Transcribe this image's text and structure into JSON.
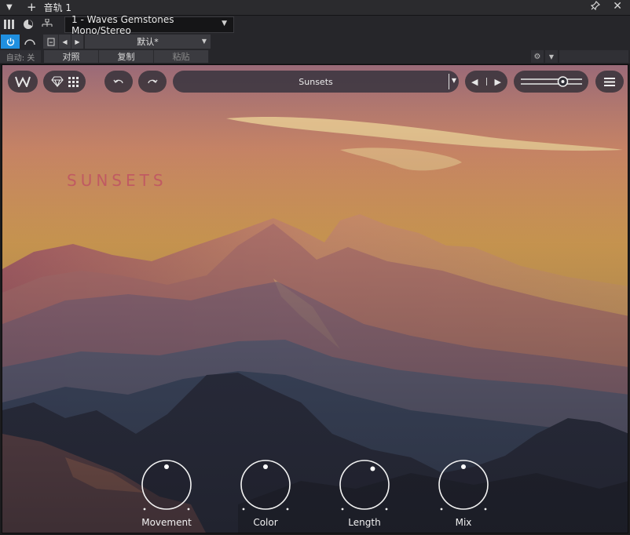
{
  "host": {
    "track_title": "音轨 1",
    "plugin_selector": "1 - Waves Gemstones Mono/Stereo",
    "preset_name": "默认*",
    "auto_label": "自动: 关",
    "compare_label": "对照",
    "copy_label": "复制",
    "paste_label": "粘贴",
    "icons": [
      "menu-icon",
      "plus-icon",
      "pin-icon",
      "close-icon",
      "mixer-icon",
      "dial-icon",
      "routing-icon",
      "power-icon",
      "bypass-icon",
      "preset-file-icon",
      "gear-icon"
    ]
  },
  "plugin": {
    "preset": "Sunsets",
    "brand": "SUNSETS",
    "output_level": 0.72,
    "colors": {
      "brand": "#c05a62",
      "accent": "#1f8fe0"
    },
    "knobs": [
      {
        "label": "Movement",
        "value": 0.5
      },
      {
        "label": "Color",
        "value": 0.5
      },
      {
        "label": "Length",
        "value": 0.6
      },
      {
        "label": "Mix",
        "value": 0.5
      }
    ]
  }
}
